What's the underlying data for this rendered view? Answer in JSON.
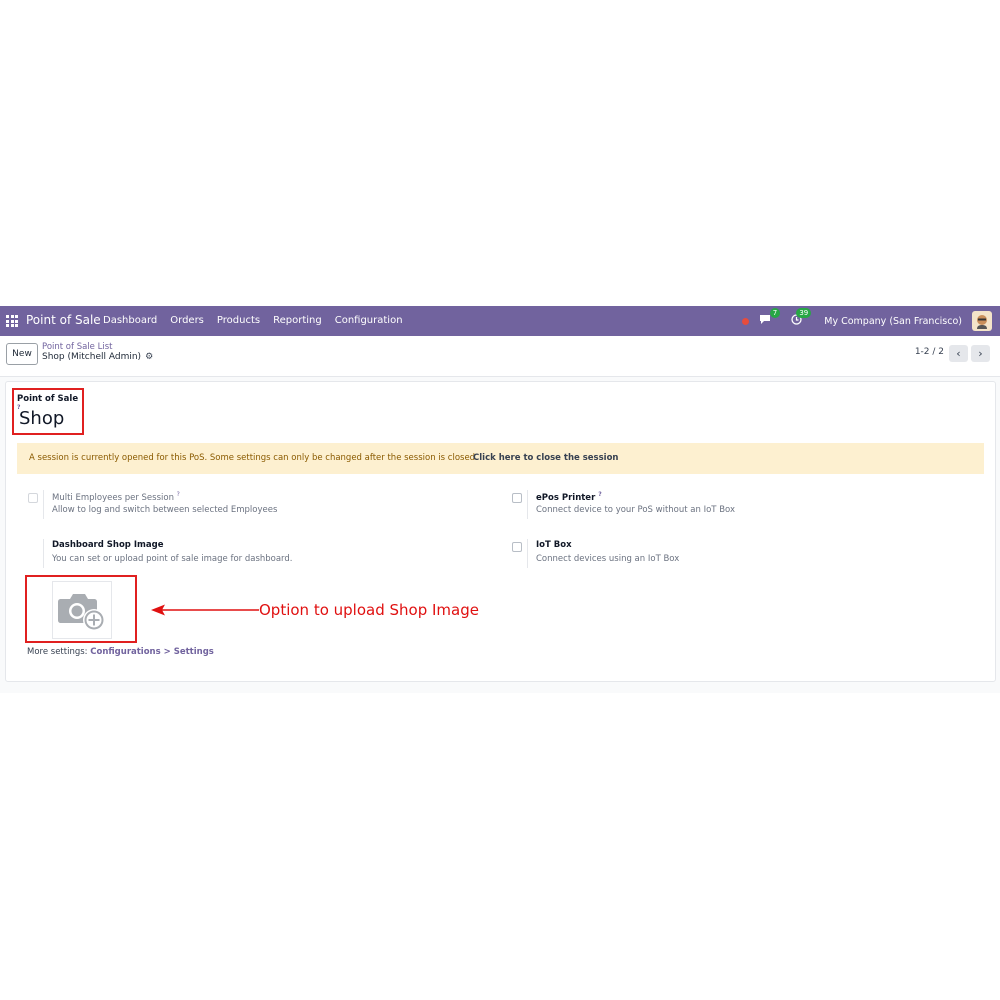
{
  "navbar": {
    "brand": "Point of Sale",
    "menu": [
      "Dashboard",
      "Orders",
      "Products",
      "Reporting",
      "Configuration"
    ],
    "messages_badge": "7",
    "activities_badge": "39",
    "company": "My Company (San Francisco)"
  },
  "control": {
    "new_label": "New",
    "breadcrumb_parent": "Point of Sale List",
    "breadcrumb_current": "Shop (Mitchell Admin)",
    "pager": "1-2 / 2"
  },
  "form": {
    "title_label": "Point of Sale",
    "title_help": "?",
    "title_value": "Shop",
    "alert_message": "A session is currently opened for this PoS. Some settings can only be changed after the session is closed.",
    "alert_link": "Click here to close the session",
    "settings": {
      "multi_employees_title": "Multi Employees per Session",
      "multi_employees_help": "?",
      "multi_employees_desc": "Allow to log and switch between selected Employees",
      "epos_title": "ePos Printer",
      "epos_help": "?",
      "epos_desc": "Connect device to your PoS without an IoT Box",
      "dashboard_image_title": "Dashboard Shop Image",
      "dashboard_image_desc": "You can set or upload point of sale image for dashboard.",
      "iot_title": "IoT Box",
      "iot_desc": "Connect devices using an IoT Box"
    },
    "annotation": "Option to upload Shop Image",
    "more_settings_prefix": "More settings:",
    "more_settings_link": "Configurations > Settings"
  },
  "colors": {
    "navbar": "#71639e",
    "alert_bg": "#fdf0d0",
    "annotation_red": "#e01010"
  }
}
